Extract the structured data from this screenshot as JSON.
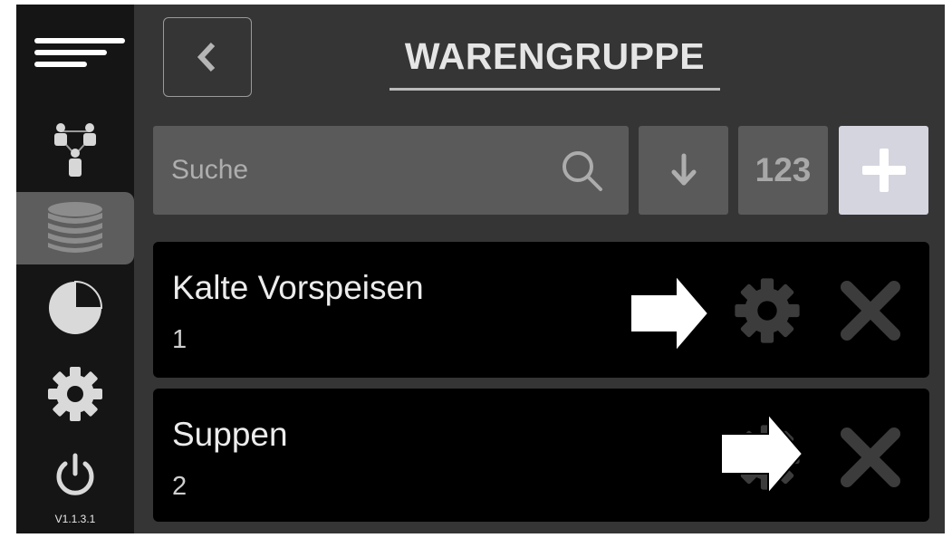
{
  "sidebar": {
    "version": "V1.1.3.1",
    "items": [
      {
        "icon": "menu-icon"
      },
      {
        "icon": "users-network-icon"
      },
      {
        "icon": "database-icon",
        "active": true
      },
      {
        "icon": "pie-chart-icon"
      },
      {
        "icon": "gear-icon"
      },
      {
        "icon": "power-icon"
      }
    ]
  },
  "header": {
    "title": "WARENGRUPPE",
    "back_icon": "chevron-left-icon"
  },
  "toolbar": {
    "search_placeholder": "Suche",
    "search_value": "",
    "sort_icon": "arrow-down-icon",
    "numeric_label": "123",
    "add_icon": "plus-icon"
  },
  "groups": [
    {
      "name": "Kalte Vorspeisen",
      "number": "1"
    },
    {
      "name": "Suppen",
      "number": "2"
    }
  ],
  "colors": {
    "background": "#353535",
    "sidebar": "#151515",
    "row": "#000000",
    "input": "#5a5a5a",
    "add_button": "#d5d5e0",
    "text": "#e5e5e5"
  }
}
